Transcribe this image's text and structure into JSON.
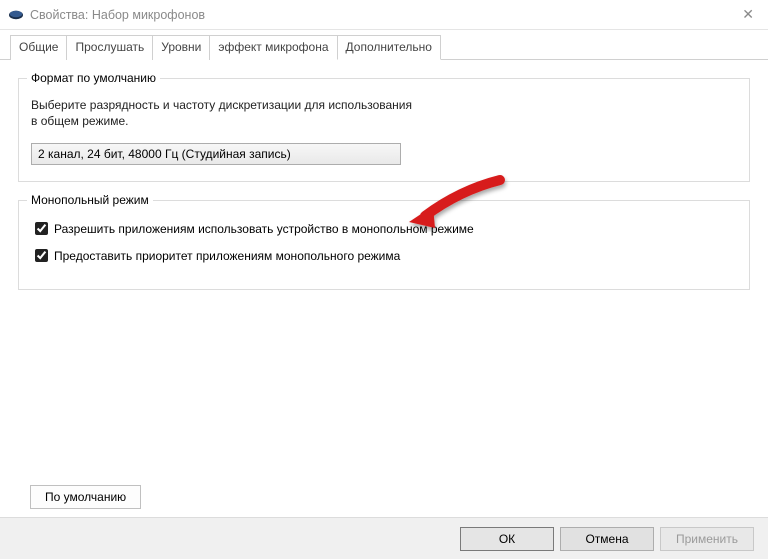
{
  "titlebar": {
    "title": "Свойства: Набор микрофонов"
  },
  "tabs": {
    "general": "Общие",
    "listen": "Прослушать",
    "levels": "Уровни",
    "effect": "эффект микрофона",
    "advanced": "Дополнительно"
  },
  "defaultFormat": {
    "legend": "Формат по умолчанию",
    "desc_line1": "Выберите разрядность и частоту дискретизации для использования",
    "desc_line2": "в общем режиме.",
    "selected": "2 канал, 24 бит, 48000 Гц (Студийная запись)"
  },
  "exclusive": {
    "legend": "Монопольный режим",
    "cb1": "Разрешить приложениям использовать устройство в монопольном режиме",
    "cb2": "Предоставить приоритет приложениям монопольного режима"
  },
  "buttons": {
    "restore": "По умолчанию",
    "ok": "ОК",
    "cancel": "Отмена",
    "apply": "Применить"
  }
}
